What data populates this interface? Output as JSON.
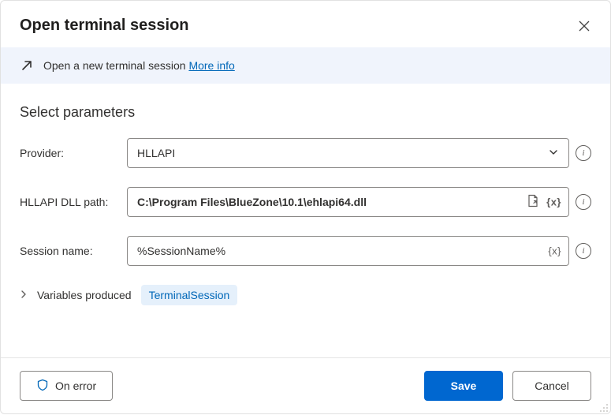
{
  "header": {
    "title": "Open terminal session"
  },
  "banner": {
    "text": "Open a new terminal session ",
    "link": "More info"
  },
  "section": {
    "title": "Select parameters"
  },
  "fields": {
    "provider": {
      "label": "Provider:",
      "value": "HLLAPI"
    },
    "dllpath": {
      "label": "HLLAPI DLL path:",
      "value": "C:\\Program Files\\BlueZone\\10.1\\ehlapi64.dll"
    },
    "session": {
      "label": "Session name:",
      "value": "%SessionName%"
    }
  },
  "vars": {
    "label": "Variables produced",
    "chip": "TerminalSession"
  },
  "footer": {
    "onerror": "On error",
    "save": "Save",
    "cancel": "Cancel"
  },
  "tokens": {
    "varx": "{x}"
  }
}
